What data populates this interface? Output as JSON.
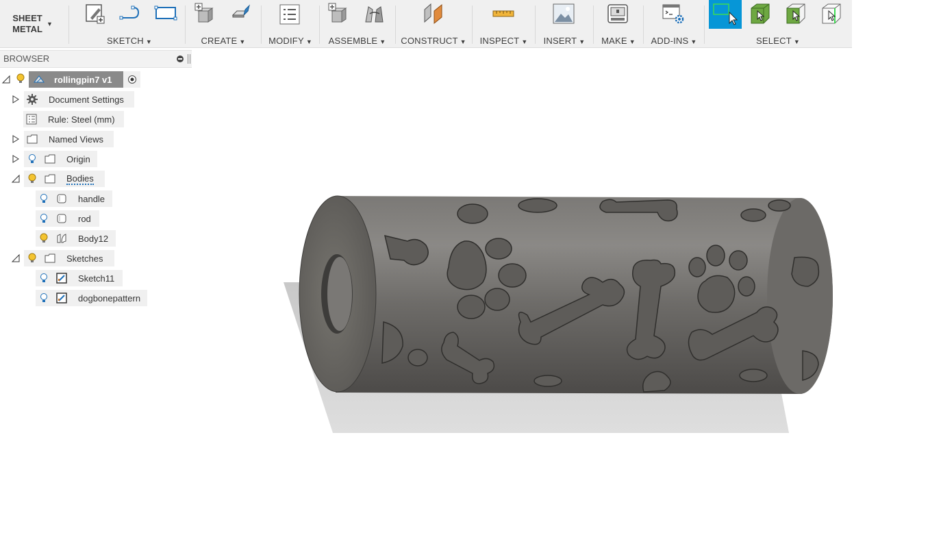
{
  "toolbar": {
    "workspace": {
      "line1": "SHEET",
      "line2": "METAL"
    },
    "groups": [
      {
        "label": "SKETCH"
      },
      {
        "label": "CREATE"
      },
      {
        "label": "MODIFY"
      },
      {
        "label": "ASSEMBLE"
      },
      {
        "label": "CONSTRUCT"
      },
      {
        "label": "INSPECT"
      },
      {
        "label": "INSERT"
      },
      {
        "label": "MAKE"
      },
      {
        "label": "ADD-INS"
      },
      {
        "label": "SELECT"
      }
    ],
    "accent": "#0696d7"
  },
  "browser": {
    "title": "BROWSER",
    "root": "rollingpin7 v1",
    "items": [
      {
        "label": "Document Settings",
        "icon": "gear-icon"
      },
      {
        "label": "Rule: Steel (mm)",
        "icon": "rule-table-icon"
      },
      {
        "label": "Named Views",
        "icon": "folder-icon"
      },
      {
        "label": "Origin",
        "icon": "folder-icon"
      },
      {
        "label": "Bodies",
        "icon": "folder-icon"
      },
      {
        "label": "handle",
        "icon": "body-icon"
      },
      {
        "label": "rod",
        "icon": "body-icon"
      },
      {
        "label": "Body12",
        "icon": "sheetmetal-body-icon"
      },
      {
        "label": "Sketches",
        "icon": "folder-icon"
      },
      {
        "label": "Sketch11",
        "icon": "sketch-icon"
      },
      {
        "label": "dogbonepattern",
        "icon": "sketch-icon"
      }
    ]
  },
  "viewport": {
    "model": "rolling-pin-with-paw-and-bone-pattern",
    "body_color": "#6e6c69"
  }
}
